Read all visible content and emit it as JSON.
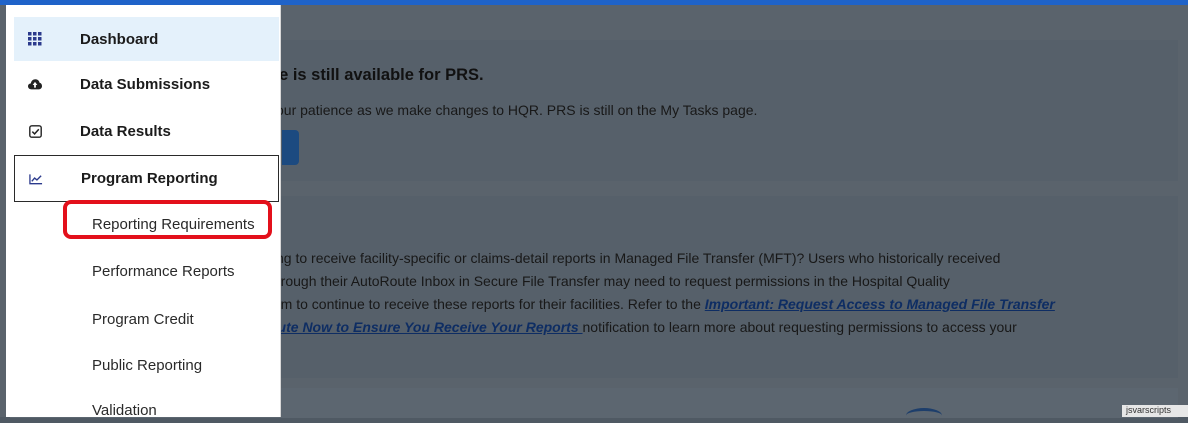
{
  "alert": {
    "title": "ge is still available for PRS.",
    "body": " your patience as we make changes to HQR. PRS is still on the My Tasks page."
  },
  "notice": {
    "line1": "ting to receive facility-specific or claims-detail reports in Managed File Transfer (MFT)? Users who historically received",
    "line2": " through their AutoRoute Inbox in Secure File Transfer may need to request permissions in the Hospital Quality",
    "line3_pre": "tem to continue to receive these reports for their facilities. Refer to the ",
    "line3_link": "Important: Request Access to Managed File Transfer",
    "line4_link": "oute Now to Ensure You Receive Your Reports ",
    "line4_post": "notification to learn more about requesting permissions to access your"
  },
  "cookie_text": "jsvarscripts",
  "sidebar": {
    "items": [
      {
        "label": "Dashboard",
        "icon": "grid-icon"
      },
      {
        "label": "Data Submissions",
        "icon": "cloud-upload-icon"
      },
      {
        "label": "Data Results",
        "icon": "checkbox-icon"
      },
      {
        "label": "Program Reporting",
        "icon": "line-chart-icon"
      }
    ],
    "subitems": [
      "Reporting Requirements",
      "Performance Reports",
      "Program Credit",
      "Public Reporting",
      "Validation"
    ]
  },
  "colors": {
    "accent": "#1f63c9",
    "active_bg": "#e4f1fb",
    "highlight": "#e3101b",
    "overlay": "#5a636c"
  }
}
